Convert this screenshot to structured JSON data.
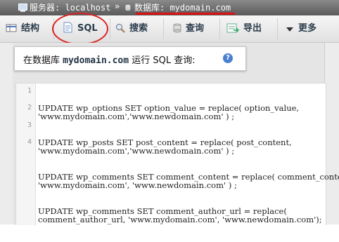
{
  "breadcrumb": {
    "server_label": "服务器: localhost",
    "separator": "»",
    "database_label": "数据库: mydomain.com"
  },
  "tabs": [
    {
      "label": "结构",
      "icon": "structure-icon"
    },
    {
      "label": "SQL",
      "icon": "sql-icon"
    },
    {
      "label": "搜索",
      "icon": "search-icon"
    },
    {
      "label": "查询",
      "icon": "query-icon"
    },
    {
      "label": "导出",
      "icon": "export-icon"
    },
    {
      "label": "更多",
      "icon": "chevron-down-icon"
    }
  ],
  "sql_header": {
    "prefix": "在数据库",
    "database": "mydomain.com",
    "suffix": "运行 SQL 查询:",
    "help_icon": "help-icon"
  },
  "editor": {
    "line_numbers": [
      "1",
      "2",
      "3",
      "4"
    ],
    "lines": [
      "UPDATE wp_options SET option_value = replace( option_value,\n'www.mydomain.com','www.newdomain.com' ) ;",
      "UPDATE wp_posts SET post_content = replace( post_content,\n'www.mydomain.com','www.newdomain.com' ) ;",
      "UPDATE wp_comments SET comment_content = replace( comment_content,\n'www.mydomain.com', 'www.newdomain.com' ) ;",
      "UPDATE wp_comments SET comment_author_url = replace(\ncomment_author_url, 'www.mydomain.com', 'www.newdomain.com');"
    ]
  },
  "colors": {
    "annotation_red": "#dd2222",
    "topbar": "#6e6e6e",
    "sql_keyword": "#8b1a8b",
    "sql_string": "#aa1111"
  }
}
